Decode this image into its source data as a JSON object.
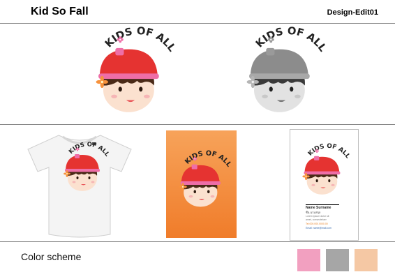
{
  "header": {
    "title": "Kid So Fall",
    "code": "Design-Edit01"
  },
  "logo": {
    "text": "KIDS OF ALL"
  },
  "business_card": {
    "name": "Name Surname",
    "subtitle": "ชื่อ-นามสกุล",
    "lines": [
      "Lorem ipsum dolor sit",
      "amet, consectetuer",
      "Tel.000.000.0000.00",
      "Email: name@mail.com"
    ]
  },
  "color_scheme": {
    "label": "Color scheme",
    "colors": [
      "#f2a0c0",
      "#a6a6a6",
      "#f5c8a4"
    ]
  },
  "palette": {
    "hat_red": "#e53331",
    "hat_pink": "#ee6ea7",
    "hair": "#4a2a17",
    "skin": "#fbe1cf",
    "orange": "#f7923c"
  }
}
